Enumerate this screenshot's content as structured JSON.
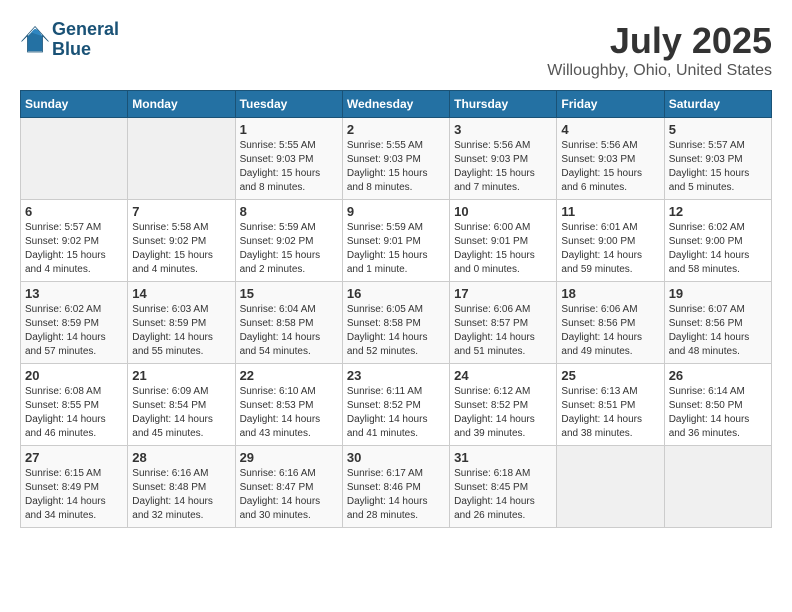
{
  "logo": {
    "line1": "General",
    "line2": "Blue"
  },
  "title": "July 2025",
  "subtitle": "Willoughby, Ohio, United States",
  "weekdays": [
    "Sunday",
    "Monday",
    "Tuesday",
    "Wednesday",
    "Thursday",
    "Friday",
    "Saturday"
  ],
  "weeks": [
    [
      {
        "day": "",
        "info": ""
      },
      {
        "day": "",
        "info": ""
      },
      {
        "day": "1",
        "info": "Sunrise: 5:55 AM\nSunset: 9:03 PM\nDaylight: 15 hours\nand 8 minutes."
      },
      {
        "day": "2",
        "info": "Sunrise: 5:55 AM\nSunset: 9:03 PM\nDaylight: 15 hours\nand 8 minutes."
      },
      {
        "day": "3",
        "info": "Sunrise: 5:56 AM\nSunset: 9:03 PM\nDaylight: 15 hours\nand 7 minutes."
      },
      {
        "day": "4",
        "info": "Sunrise: 5:56 AM\nSunset: 9:03 PM\nDaylight: 15 hours\nand 6 minutes."
      },
      {
        "day": "5",
        "info": "Sunrise: 5:57 AM\nSunset: 9:03 PM\nDaylight: 15 hours\nand 5 minutes."
      }
    ],
    [
      {
        "day": "6",
        "info": "Sunrise: 5:57 AM\nSunset: 9:02 PM\nDaylight: 15 hours\nand 4 minutes."
      },
      {
        "day": "7",
        "info": "Sunrise: 5:58 AM\nSunset: 9:02 PM\nDaylight: 15 hours\nand 4 minutes."
      },
      {
        "day": "8",
        "info": "Sunrise: 5:59 AM\nSunset: 9:02 PM\nDaylight: 15 hours\nand 2 minutes."
      },
      {
        "day": "9",
        "info": "Sunrise: 5:59 AM\nSunset: 9:01 PM\nDaylight: 15 hours\nand 1 minute."
      },
      {
        "day": "10",
        "info": "Sunrise: 6:00 AM\nSunset: 9:01 PM\nDaylight: 15 hours\nand 0 minutes."
      },
      {
        "day": "11",
        "info": "Sunrise: 6:01 AM\nSunset: 9:00 PM\nDaylight: 14 hours\nand 59 minutes."
      },
      {
        "day": "12",
        "info": "Sunrise: 6:02 AM\nSunset: 9:00 PM\nDaylight: 14 hours\nand 58 minutes."
      }
    ],
    [
      {
        "day": "13",
        "info": "Sunrise: 6:02 AM\nSunset: 8:59 PM\nDaylight: 14 hours\nand 57 minutes."
      },
      {
        "day": "14",
        "info": "Sunrise: 6:03 AM\nSunset: 8:59 PM\nDaylight: 14 hours\nand 55 minutes."
      },
      {
        "day": "15",
        "info": "Sunrise: 6:04 AM\nSunset: 8:58 PM\nDaylight: 14 hours\nand 54 minutes."
      },
      {
        "day": "16",
        "info": "Sunrise: 6:05 AM\nSunset: 8:58 PM\nDaylight: 14 hours\nand 52 minutes."
      },
      {
        "day": "17",
        "info": "Sunrise: 6:06 AM\nSunset: 8:57 PM\nDaylight: 14 hours\nand 51 minutes."
      },
      {
        "day": "18",
        "info": "Sunrise: 6:06 AM\nSunset: 8:56 PM\nDaylight: 14 hours\nand 49 minutes."
      },
      {
        "day": "19",
        "info": "Sunrise: 6:07 AM\nSunset: 8:56 PM\nDaylight: 14 hours\nand 48 minutes."
      }
    ],
    [
      {
        "day": "20",
        "info": "Sunrise: 6:08 AM\nSunset: 8:55 PM\nDaylight: 14 hours\nand 46 minutes."
      },
      {
        "day": "21",
        "info": "Sunrise: 6:09 AM\nSunset: 8:54 PM\nDaylight: 14 hours\nand 45 minutes."
      },
      {
        "day": "22",
        "info": "Sunrise: 6:10 AM\nSunset: 8:53 PM\nDaylight: 14 hours\nand 43 minutes."
      },
      {
        "day": "23",
        "info": "Sunrise: 6:11 AM\nSunset: 8:52 PM\nDaylight: 14 hours\nand 41 minutes."
      },
      {
        "day": "24",
        "info": "Sunrise: 6:12 AM\nSunset: 8:52 PM\nDaylight: 14 hours\nand 39 minutes."
      },
      {
        "day": "25",
        "info": "Sunrise: 6:13 AM\nSunset: 8:51 PM\nDaylight: 14 hours\nand 38 minutes."
      },
      {
        "day": "26",
        "info": "Sunrise: 6:14 AM\nSunset: 8:50 PM\nDaylight: 14 hours\nand 36 minutes."
      }
    ],
    [
      {
        "day": "27",
        "info": "Sunrise: 6:15 AM\nSunset: 8:49 PM\nDaylight: 14 hours\nand 34 minutes."
      },
      {
        "day": "28",
        "info": "Sunrise: 6:16 AM\nSunset: 8:48 PM\nDaylight: 14 hours\nand 32 minutes."
      },
      {
        "day": "29",
        "info": "Sunrise: 6:16 AM\nSunset: 8:47 PM\nDaylight: 14 hours\nand 30 minutes."
      },
      {
        "day": "30",
        "info": "Sunrise: 6:17 AM\nSunset: 8:46 PM\nDaylight: 14 hours\nand 28 minutes."
      },
      {
        "day": "31",
        "info": "Sunrise: 6:18 AM\nSunset: 8:45 PM\nDaylight: 14 hours\nand 26 minutes."
      },
      {
        "day": "",
        "info": ""
      },
      {
        "day": "",
        "info": ""
      }
    ]
  ]
}
